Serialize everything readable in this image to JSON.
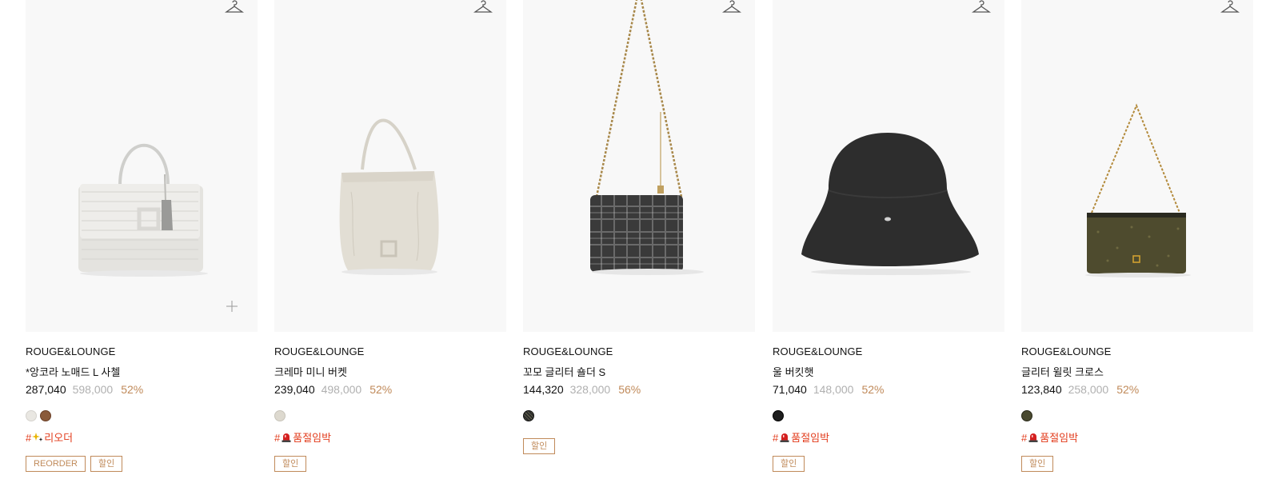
{
  "products": [
    {
      "brand": "ROUGE&LOUNGE",
      "name": "*앙코라 노매드 L 사첼",
      "sale_price": "287,040",
      "original_price": "598,000",
      "discount": "52%",
      "swatches": [
        "#e9e7e2",
        "#8a5a3a"
      ],
      "hashtag_prefix": "#",
      "hashtag_icon": "sparkle-icon",
      "hashtag_text": "리오더",
      "badges": [
        "REORDER",
        "할인"
      ],
      "has_plus": true
    },
    {
      "brand": "ROUGE&LOUNGE",
      "name": "크레마 미니 버켓",
      "sale_price": "239,040",
      "original_price": "498,000",
      "discount": "52%",
      "swatches": [
        "#ddd9cf"
      ],
      "hashtag_prefix": "#",
      "hashtag_icon": "siren-icon",
      "hashtag_text": "품절임박",
      "badges": [
        "할인"
      ],
      "has_plus": false
    },
    {
      "brand": "ROUGE&LOUNGE",
      "name": "꼬모 글리터 숄더 S",
      "sale_price": "144,320",
      "original_price": "328,000",
      "discount": "56%",
      "swatches": [
        "#2c2c2c"
      ],
      "hashtag_prefix": "",
      "hashtag_icon": "",
      "hashtag_text": "",
      "badges": [
        "할인"
      ],
      "has_plus": false
    },
    {
      "brand": "ROUGE&LOUNGE",
      "name": "울 버킷햇",
      "sale_price": "71,040",
      "original_price": "148,000",
      "discount": "52%",
      "swatches": [
        "#1e1e1e"
      ],
      "hashtag_prefix": "#",
      "hashtag_icon": "siren-icon",
      "hashtag_text": "품절임박",
      "badges": [
        "할인"
      ],
      "has_plus": false
    },
    {
      "brand": "ROUGE&LOUNGE",
      "name": "글리터 윌릿 크로스",
      "sale_price": "123,840",
      "original_price": "258,000",
      "discount": "52%",
      "swatches": [
        "#4a4a30"
      ],
      "hashtag_prefix": "#",
      "hashtag_icon": "siren-icon",
      "hashtag_text": "품절임박",
      "badges": [
        "할인"
      ],
      "has_plus": false
    }
  ],
  "icons": {
    "wishlist": "hanger-icon",
    "add": "plus-icon"
  },
  "colors": {
    "price_discount": "#c08a5a",
    "hashtag": "#e23c1c",
    "original_price": "#b0b0b0",
    "thumb_bg": "#f8f8f8"
  }
}
